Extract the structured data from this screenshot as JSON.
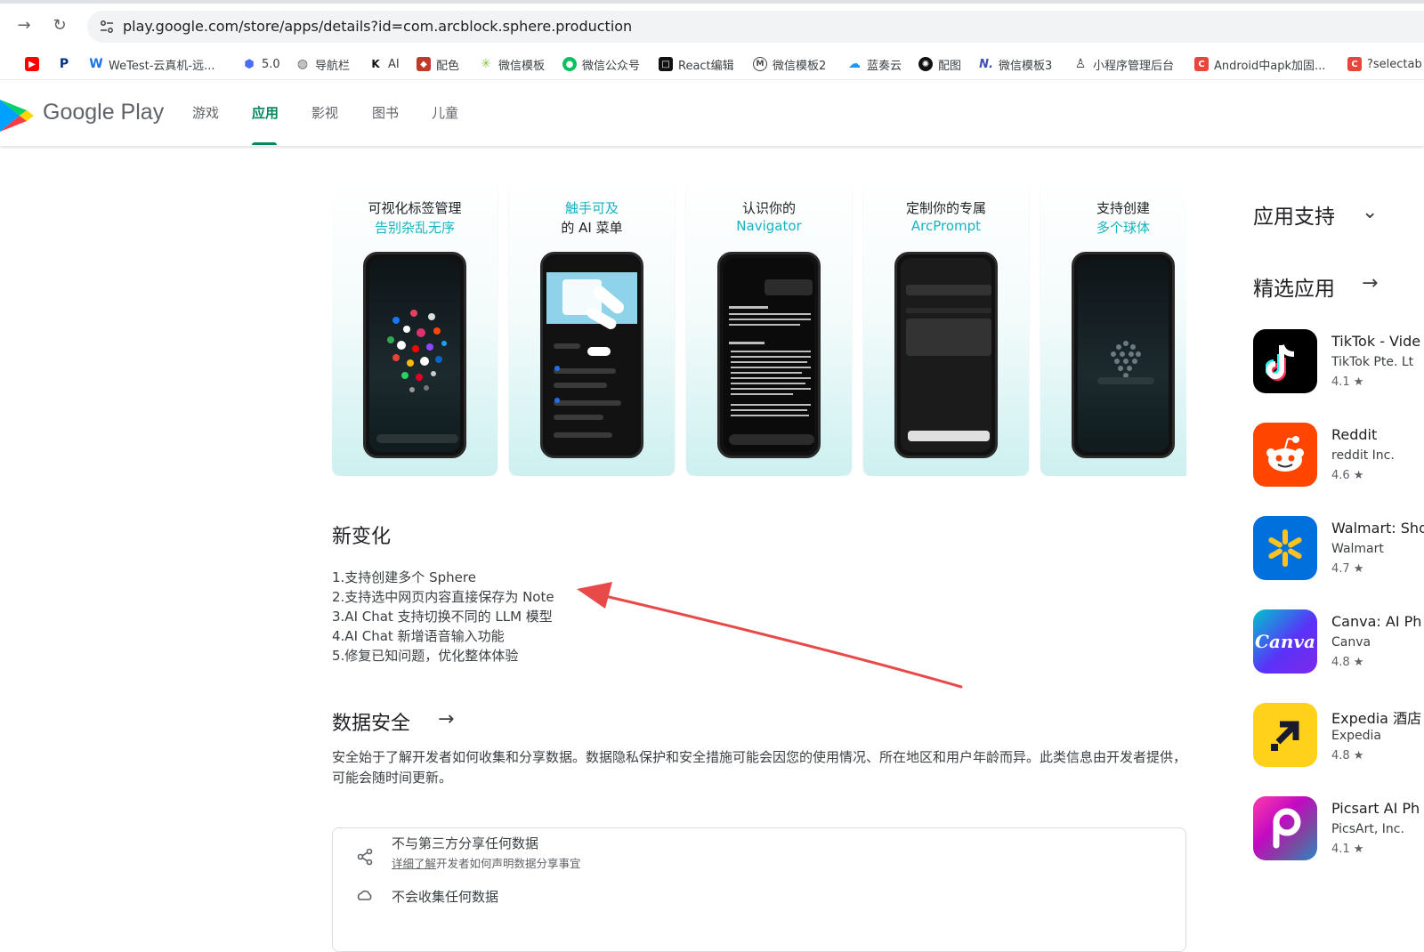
{
  "browser": {
    "url": "play.google.com/store/apps/details?id=com.arcblock.sphere.production",
    "bookmarks": [
      {
        "label": "",
        "icon": "youtube-icon",
        "color": "#ff0000"
      },
      {
        "label": "",
        "icon": "paypal-icon",
        "color": "#003087"
      },
      {
        "label": "WeTest-云真机-远...",
        "icon": "wetest-icon",
        "color": "#1a73e8"
      },
      {
        "label": "5.0",
        "icon": "badge-icon",
        "color": "#4a6cf7"
      },
      {
        "label": "导航栏",
        "icon": "globe-icon",
        "color": "#5f6368"
      },
      {
        "label": "AI",
        "icon": "k-icon",
        "color": "#111111"
      },
      {
        "label": "配色",
        "icon": "palette-icon",
        "color": "#c0392b"
      },
      {
        "label": "微信模板",
        "icon": "sparkle-icon",
        "color": "#8bc34a"
      },
      {
        "label": "微信公众号",
        "icon": "wechat-icon",
        "color": "#07c160"
      },
      {
        "label": "React编辑",
        "icon": "square-icon",
        "color": "#111111"
      },
      {
        "label": "微信模板2",
        "icon": "m-circle-icon",
        "color": "#444444"
      },
      {
        "label": "蓝奏云",
        "icon": "cloud-icon",
        "color": "#2196f3"
      },
      {
        "label": "配图",
        "icon": "openai-icon",
        "color": "#111111"
      },
      {
        "label": "微信模板3",
        "icon": "n-icon",
        "color": "#3f51b5"
      },
      {
        "label": "小程序管理后台",
        "icon": "person-icon",
        "color": "#333333"
      },
      {
        "label": "Android中apk加固...",
        "icon": "c-icon",
        "color": "#e8453c"
      },
      {
        "label": "?selectab",
        "icon": "c-icon",
        "color": "#e8453c"
      }
    ]
  },
  "header": {
    "brand": "Google Play",
    "tabs": [
      {
        "label": "游戏",
        "active": false
      },
      {
        "label": "应用",
        "active": true
      },
      {
        "label": "影视",
        "active": false
      },
      {
        "label": "图书",
        "active": false
      },
      {
        "label": "儿童",
        "active": false
      }
    ]
  },
  "screenshots": [
    {
      "line1": "可视化标签管理",
      "line2": "告别杂乱无序"
    },
    {
      "line1": "触手可及",
      "line2": "的 AI 菜单"
    },
    {
      "line1": "认识你的",
      "line2": "Navigator"
    },
    {
      "line1": "定制你的专属",
      "line2": "ArcPrompt"
    },
    {
      "line1": "支持创建",
      "line2": "多个球体"
    }
  ],
  "whats_new": {
    "title": "新变化",
    "items": [
      "1.支持创建多个 Sphere",
      "2.支持选中网页内容直接保存为 Note",
      "3.AI Chat 支持切换不同的 LLM 模型",
      "4.AI Chat 新增语音输入功能",
      "5.修复已知问题，优化整体体验"
    ]
  },
  "data_safety": {
    "title": "数据安全",
    "description": "安全始于了解开发者如何收集和分享数据。数据隐私保护和安全措施可能会因您的使用情况、所在地区和用户年龄而异。此类信息由开发者提供，可能会随时间更新。",
    "items": [
      {
        "title": "不与第三方分享任何数据",
        "link": "详细了解",
        "sub": "开发者如何声明数据分享事宜"
      },
      {
        "title": "不会收集任何数据",
        "link": "",
        "sub": ""
      }
    ]
  },
  "sidebar": {
    "support_title": "应用支持",
    "featured_title": "精选应用",
    "apps": [
      {
        "name": "TikTok - Vide",
        "developer": "TikTok Pte. Lt",
        "rating": "4.1 ★",
        "icon": "tiktok-icon",
        "bg": "#000000"
      },
      {
        "name": "Reddit",
        "developer": "reddit Inc.",
        "rating": "4.6 ★",
        "icon": "reddit-icon",
        "bg": "#ff4500"
      },
      {
        "name": "Walmart: Sho",
        "developer": "Walmart",
        "rating": "4.7 ★",
        "icon": "walmart-icon",
        "bg": "#0071dc"
      },
      {
        "name": "Canva: AI Ph",
        "developer": "Canva",
        "rating": "4.8 ★",
        "icon": "canva-icon",
        "bg": "#7d2ae8"
      },
      {
        "name": "Expedia 酒店",
        "developer": "Expedia",
        "rating": "4.8 ★",
        "icon": "expedia-icon",
        "bg": "#ffd11a"
      },
      {
        "name": "Picsart AI Ph",
        "developer": "PicsArt, Inc.",
        "rating": "4.1 ★",
        "icon": "picsart-icon",
        "bg": "#c209c1"
      }
    ]
  }
}
